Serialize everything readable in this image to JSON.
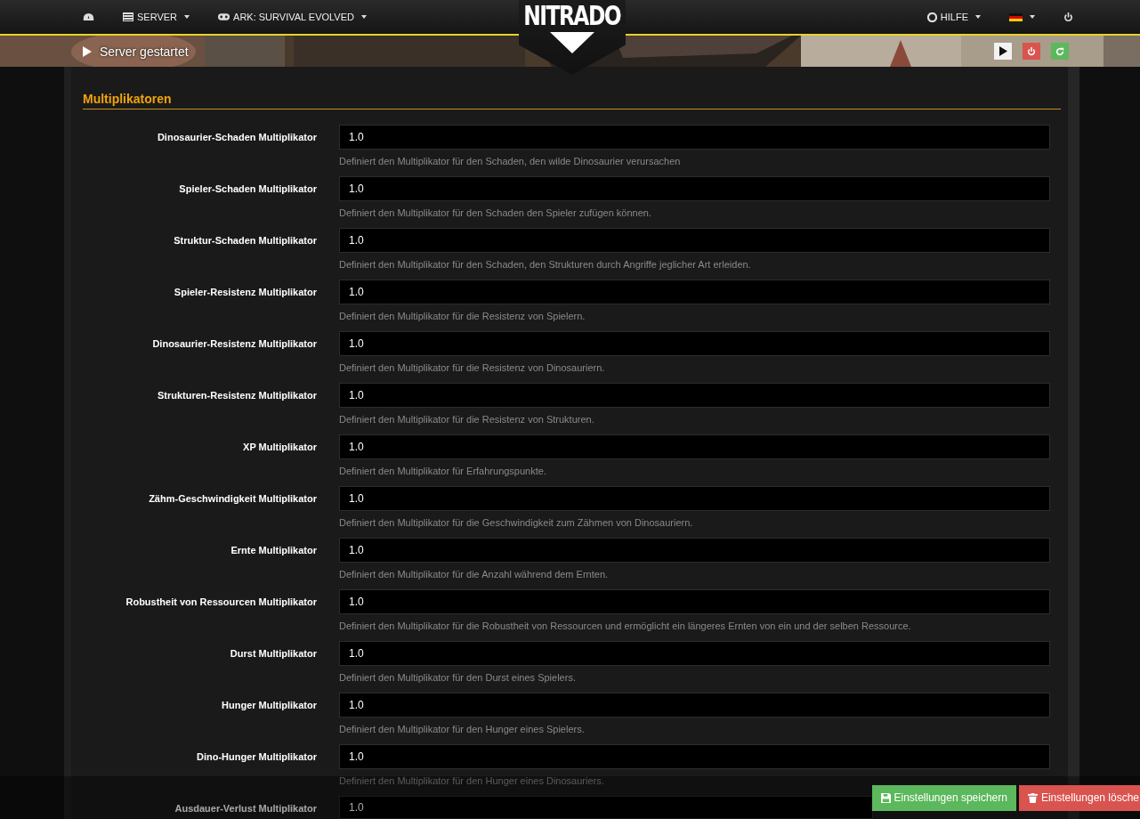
{
  "nav": {
    "left": [
      {
        "kind": "dashboard"
      },
      {
        "kind": "server",
        "label": "SERVER"
      },
      {
        "kind": "game",
        "label": "ARK: SURVIVAL EVOLVED"
      }
    ],
    "logo": "NITRADO",
    "right": [
      {
        "kind": "help",
        "label": "HILFE"
      },
      {
        "kind": "language"
      },
      {
        "kind": "logout"
      }
    ]
  },
  "banner": {
    "status": "Server gestartet",
    "controls": [
      {
        "kind": "start"
      },
      {
        "kind": "stop"
      },
      {
        "kind": "restart"
      }
    ]
  },
  "section": {
    "title": "Multiplikatoren",
    "fields": [
      {
        "label": "Dinosaurier-Schaden Multiplikator",
        "value": "1.0",
        "help": "Definiert den Multiplikator für den Schaden, den wilde Dinosaurier verursachen"
      },
      {
        "label": "Spieler-Schaden Multiplikator",
        "value": "1.0",
        "help": "Definiert den Multiplikator für den Schaden den Spieler zufügen können."
      },
      {
        "label": "Struktur-Schaden Multiplikator",
        "value": "1.0",
        "help": "Definiert den Multiplikator für den Schaden, den Strukturen durch Angriffe jeglicher Art erleiden."
      },
      {
        "label": "Spieler-Resistenz Multiplikator",
        "value": "1.0",
        "help": "Definiert den Multiplikator für die Resistenz von Spielern."
      },
      {
        "label": "Dinosaurier-Resistenz Multiplikator",
        "value": "1.0",
        "help": "Definiert den Multiplikator für die Resistenz von Dinosauriern."
      },
      {
        "label": "Strukturen-Resistenz Multiplikator",
        "value": "1.0",
        "help": "Definiert den Multiplikator für die Resistenz von Strukturen."
      },
      {
        "label": "XP Multiplikator",
        "value": "1.0",
        "help": "Definiert den Multiplikator für Erfahrungspunkte."
      },
      {
        "label": "Zähm-Geschwindigkeit Multiplikator",
        "value": "1.0",
        "help": "Definiert den Multiplikator für die Geschwindigkeit zum Zähmen von Dinosauriern."
      },
      {
        "label": "Ernte Multiplikator",
        "value": "1.0",
        "help": "Definiert den Multiplikator für die Anzahl während dem Ernten."
      },
      {
        "label": "Robustheit von Ressourcen Multiplikator",
        "value": "1.0",
        "help": "Definiert den Multiplikator für die Robustheit von Ressourcen und ermöglicht ein längeres Ernten von ein und der selben Ressource."
      },
      {
        "label": "Durst Multiplikator",
        "value": "1.0",
        "help": "Definiert den Multiplikator für den Durst eines Spielers."
      },
      {
        "label": "Hunger Multiplikator",
        "value": "1.0",
        "help": "Definiert den Multiplikator für den Hunger eines Spielers."
      },
      {
        "label": "Dino-Hunger Multiplikator",
        "value": "1.0",
        "help": "Definiert den Multiplikator für den Hunger eines Dinosauriers."
      },
      {
        "label": "Ausdauer-Verlust Multiplikator",
        "value": "1.0"
      }
    ]
  },
  "footer": [
    {
      "kind": "save",
      "label": "Einstellungen speichern"
    },
    {
      "kind": "delete",
      "label": "Einstellungen lösche"
    }
  ]
}
